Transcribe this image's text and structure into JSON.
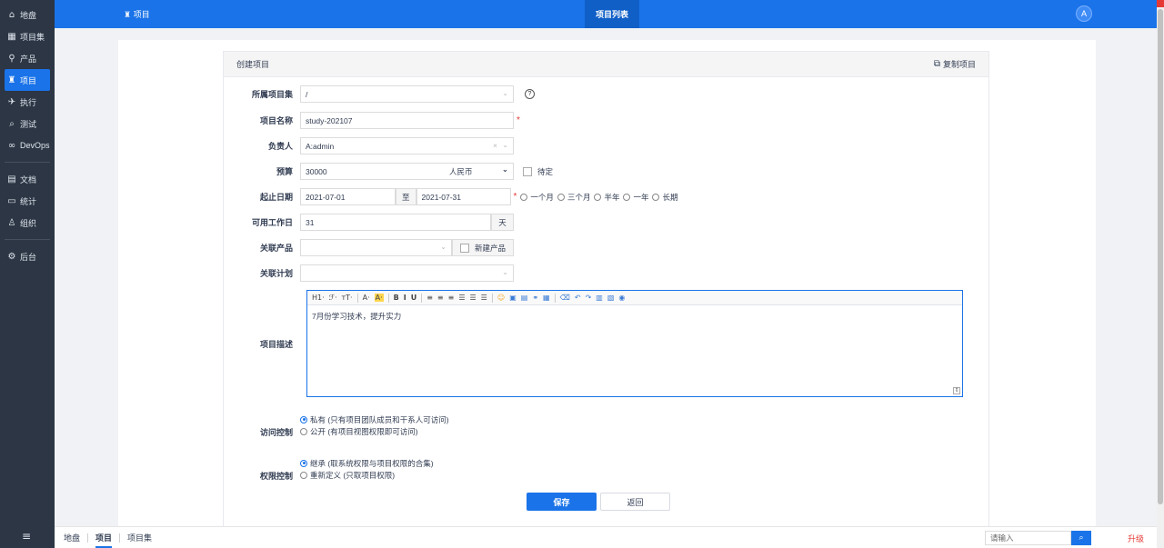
{
  "sidebar": {
    "items": [
      {
        "icon": "⌂",
        "label": "地盘"
      },
      {
        "icon": "▦",
        "label": "项目集"
      },
      {
        "icon": "⚲",
        "label": "产品"
      },
      {
        "icon": "♜",
        "label": "项目",
        "active": true
      },
      {
        "icon": "✈",
        "label": "执行"
      },
      {
        "icon": "⌕",
        "label": "测试"
      },
      {
        "icon": "∞",
        "label": "DevOps"
      },
      {
        "icon": "▤",
        "label": "文档"
      },
      {
        "icon": "▭",
        "label": "统计"
      },
      {
        "icon": "♙",
        "label": "组织"
      },
      {
        "icon": "⚙",
        "label": "后台"
      }
    ],
    "menu_icon": "≡"
  },
  "topbar": {
    "section": "♜ 项目",
    "active_tab": "项目列表",
    "avatar": "A"
  },
  "panel": {
    "title": "创建项目",
    "copy_label": "复制项目"
  },
  "form": {
    "program": {
      "label": "所属项目集",
      "value": "/"
    },
    "name": {
      "label": "项目名称",
      "value": "study-202107"
    },
    "owner": {
      "label": "负责人",
      "value": "A:admin"
    },
    "budget": {
      "label": "预算",
      "value": "30000",
      "currency": "人民币",
      "tbd_label": "待定"
    },
    "dates": {
      "label": "起止日期",
      "start": "2021-07-01",
      "to": "至",
      "end": "2021-07-31",
      "options": [
        "一个月",
        "三个月",
        "半年",
        "一年",
        "长期"
      ]
    },
    "workdays": {
      "label": "可用工作日",
      "value": "31",
      "unit": "天"
    },
    "product": {
      "label": "关联产品",
      "value": "",
      "new_label": "新建产品"
    },
    "plan": {
      "label": "关联计划",
      "value": ""
    },
    "desc": {
      "label": "项目描述",
      "content": "7月份学习技术，提升实力"
    },
    "acl": {
      "label": "访问控制",
      "options": [
        "私有 (只有项目团队成员和干系人可访问)",
        "公开 (有项目视图权限即可访问)"
      ],
      "selected": 0
    },
    "auth": {
      "label": "权限控制",
      "options": [
        "继承 (取系统权限与项目权限的合集)",
        "重新定义 (只取项目权限)"
      ],
      "selected": 0
    }
  },
  "toolbar_items": [
    "H1·",
    "ℱ·",
    "тT·",
    "A·",
    "A·",
    "B",
    "I",
    "U",
    "≡",
    "≡",
    "≡",
    "☰",
    "☰",
    "☰",
    "☺",
    "▣",
    "▤",
    "⚭",
    "▦",
    "⌫",
    "↶",
    "↷",
    "▥",
    "▧",
    "◉"
  ],
  "actions": {
    "save": "保存",
    "back": "返回"
  },
  "bottom": {
    "crumbs": [
      "地盘",
      "项目",
      "项目集"
    ],
    "active_crumb": 1,
    "search_placeholder": "请输入",
    "upgrade": "升级"
  }
}
